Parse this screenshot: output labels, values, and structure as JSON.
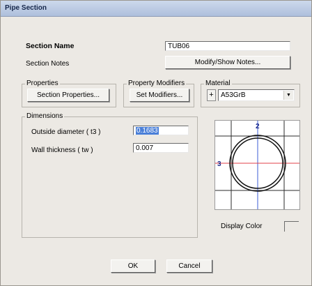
{
  "window": {
    "title": "Pipe Section"
  },
  "section": {
    "name_label": "Section Name",
    "name_value": "TUB06",
    "notes_label": "Section Notes",
    "notes_button": "Modify/Show Notes..."
  },
  "properties": {
    "group_title": "Properties",
    "button": "Section Properties..."
  },
  "modifiers": {
    "group_title": "Property Modifiers",
    "button": "Set Modifiers..."
  },
  "material": {
    "group_title": "Material",
    "add_symbol": "+",
    "selected": "A53GrB",
    "arrow_icon": "▼"
  },
  "dimensions": {
    "group_title": "Dimensions",
    "outside_diameter_label": "Outside diameter  ( t3 )",
    "outside_diameter_value": "0.1683",
    "wall_thickness_label": "Wall thickness  ( tw )",
    "wall_thickness_value": "0.007"
  },
  "preview": {
    "axis_2": "2",
    "axis_3": "3",
    "axis_color_vertical": "#3b5bd6",
    "axis_color_horizontal": "#e0404a"
  },
  "display_color": {
    "label": "Display Color"
  },
  "footer": {
    "ok": "OK",
    "cancel": "Cancel"
  }
}
